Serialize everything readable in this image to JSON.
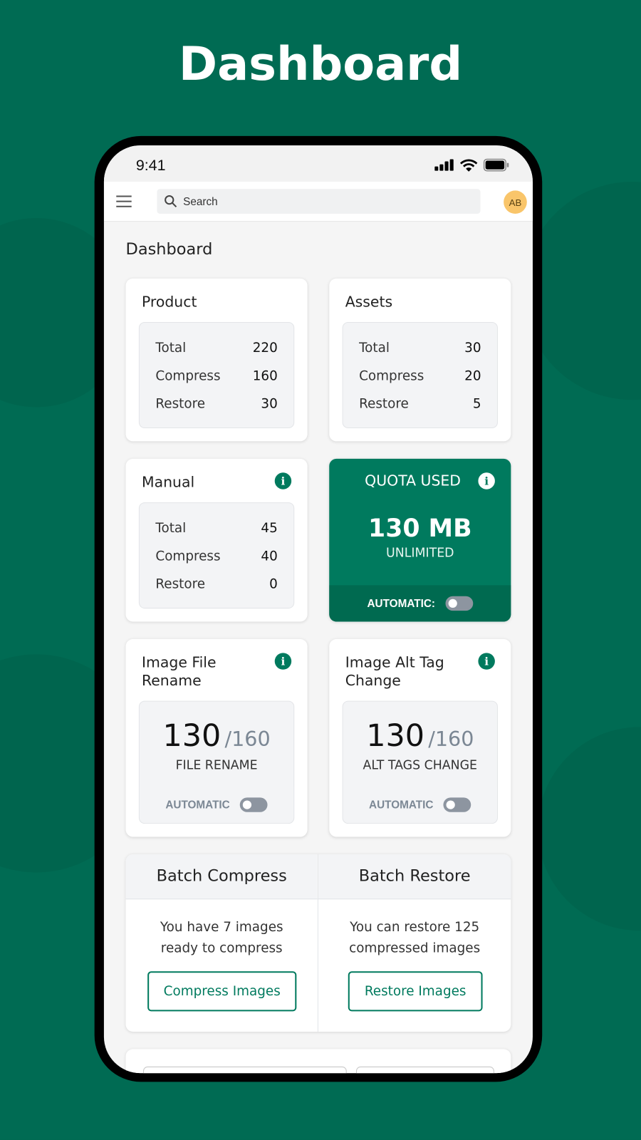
{
  "banner_title": "Dashboard",
  "status_bar": {
    "time": "9:41"
  },
  "header": {
    "search_placeholder": "Search",
    "avatar_initials": "AB"
  },
  "page_title": "Dashboard",
  "cards": {
    "product": {
      "title": "Product",
      "rows": [
        {
          "label": "Total",
          "value": "220"
        },
        {
          "label": "Compress",
          "value": "160"
        },
        {
          "label": "Restore",
          "value": "30"
        }
      ]
    },
    "assets": {
      "title": "Assets",
      "rows": [
        {
          "label": "Total",
          "value": "30"
        },
        {
          "label": "Compress",
          "value": "20"
        },
        {
          "label": "Restore",
          "value": "5"
        }
      ]
    },
    "manual": {
      "title": "Manual",
      "rows": [
        {
          "label": "Total",
          "value": "45"
        },
        {
          "label": "Compress",
          "value": "40"
        },
        {
          "label": "Restore",
          "value": "0"
        }
      ]
    },
    "quota": {
      "title": "QUOTA USED",
      "value": "130 MB",
      "subtitle": "UNLIMITED",
      "automatic_label": "AUTOMATIC:",
      "automatic_on": false
    },
    "file_rename": {
      "title": "Image File Rename",
      "count": "130",
      "total": "/160",
      "label": "FILE RENAME",
      "automatic_label": "AUTOMATIC",
      "automatic_on": false
    },
    "alt_tag": {
      "title": "Image Alt Tag Change",
      "count": "130",
      "total": "/160",
      "label": "ALT TAGS CHANGE",
      "automatic_label": "AUTOMATIC",
      "automatic_on": false
    }
  },
  "batch": {
    "compress": {
      "title": "Batch Compress",
      "text": "You have 7 images ready to compress",
      "button": "Compress Images"
    },
    "restore": {
      "title": "Batch Restore",
      "text": "You can restore 125 compressed images",
      "button": "Restore Images"
    }
  },
  "colors": {
    "brand": "#007a5e",
    "background": "#006b53",
    "avatar": "#f9c56a"
  }
}
